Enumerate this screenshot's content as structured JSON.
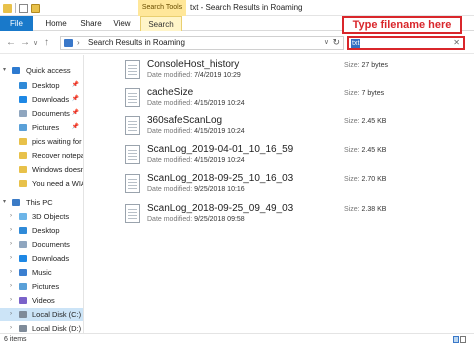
{
  "window": {
    "title": "txt - Search Results in Roaming",
    "contextual_tab": "Search Tools"
  },
  "ribbon": {
    "tabs": [
      "File",
      "Home",
      "Share",
      "View",
      "Search"
    ]
  },
  "address": {
    "breadcrumb": "Search Results in Roaming",
    "search_value": "txt"
  },
  "callout": {
    "text": "Type filename here"
  },
  "sidebar": {
    "items": [
      {
        "label": "Quick access",
        "icon": "star-icon",
        "pinned": false
      },
      {
        "label": "Desktop",
        "icon": "desktop-icon",
        "pinned": true
      },
      {
        "label": "Downloads",
        "icon": "downloads-icon",
        "pinned": true
      },
      {
        "label": "Documents",
        "icon": "documents-icon",
        "pinned": true
      },
      {
        "label": "Pictures",
        "icon": "pictures-icon",
        "pinned": true
      },
      {
        "label": "pics waiting for",
        "icon": "folder-icon",
        "pinned": false
      },
      {
        "label": "Recover notepac",
        "icon": "folder-icon",
        "pinned": false
      },
      {
        "label": "Windows doesn'",
        "icon": "folder-icon",
        "pinned": false
      },
      {
        "label": "You need a WIA",
        "icon": "folder-icon",
        "pinned": false
      },
      {
        "label": "This PC",
        "icon": "pc-icon",
        "pinned": false
      },
      {
        "label": "3D Objects",
        "icon": "3d-objects-icon",
        "pinned": false
      },
      {
        "label": "Desktop",
        "icon": "desktop-icon",
        "pinned": false
      },
      {
        "label": "Documents",
        "icon": "documents-icon",
        "pinned": false
      },
      {
        "label": "Downloads",
        "icon": "downloads-icon",
        "pinned": false
      },
      {
        "label": "Music",
        "icon": "music-icon",
        "pinned": false
      },
      {
        "label": "Pictures",
        "icon": "pictures-icon",
        "pinned": false
      },
      {
        "label": "Videos",
        "icon": "videos-icon",
        "pinned": false
      },
      {
        "label": "Local Disk (C:)",
        "icon": "disk-icon",
        "pinned": false
      },
      {
        "label": "Local Disk (D:)",
        "icon": "disk-icon",
        "pinned": false
      }
    ]
  },
  "files": {
    "modified_label": "Date modified:",
    "size_label": "Size:",
    "rows": [
      {
        "name": "ConsoleHost_history",
        "modified": "7/4/2019 10:29",
        "size": "27 bytes"
      },
      {
        "name": "cacheSize",
        "modified": "4/15/2019 10:24",
        "size": "7 bytes"
      },
      {
        "name": "360safeScanLog",
        "modified": "4/15/2019 10:24",
        "size": "2.45 KB"
      },
      {
        "name": "ScanLog_2019-04-01_10_16_59",
        "modified": "4/15/2019 10:24",
        "size": "2.45 KB"
      },
      {
        "name": "ScanLog_2018-09-25_10_16_03",
        "modified": "9/25/2018 10:16",
        "size": "2.70 KB"
      },
      {
        "name": "ScanLog_2018-09-25_09_49_03",
        "modified": "9/25/2018 09:58",
        "size": "2.38 KB"
      }
    ]
  },
  "status": {
    "item_count": "6 items"
  }
}
